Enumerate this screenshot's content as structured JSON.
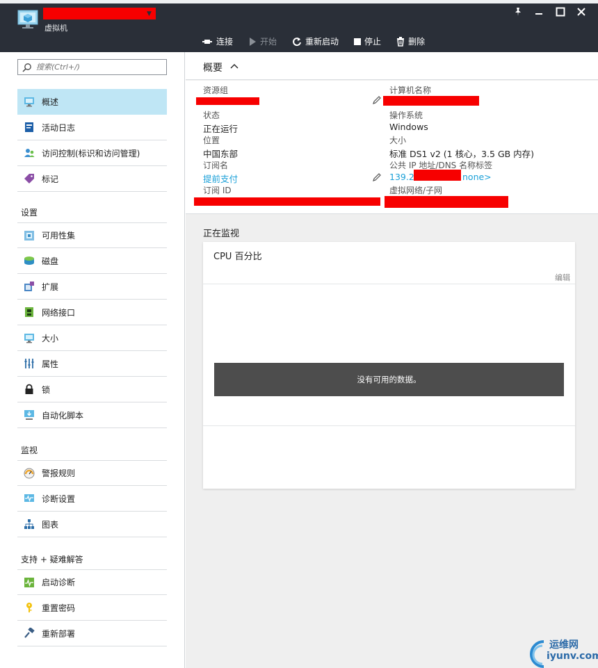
{
  "header": {
    "subtitle": "虚拟机",
    "icons": [
      "vm-monitor-icon",
      "pin-icon",
      "minimize-icon",
      "maximize-icon",
      "close-icon"
    ],
    "toolbar": [
      {
        "label": "连接",
        "icon": "connect-icon"
      },
      {
        "label": "开始",
        "icon": "play-icon"
      },
      {
        "label": "重新启动",
        "icon": "restart-icon"
      },
      {
        "label": "停止",
        "icon": "stop-icon"
      },
      {
        "label": "删除",
        "icon": "trash-icon"
      }
    ]
  },
  "sidebar": {
    "search_placeholder": "搜索(Ctrl+/)",
    "items": [
      {
        "label": "概述",
        "icon": "overview-monitor-icon",
        "active": true
      },
      {
        "label": "活动日志",
        "icon": "activity-log-icon"
      },
      {
        "label": "访问控制(标识和访问管理)",
        "icon": "access-control-icon"
      },
      {
        "label": "标记",
        "icon": "tag-icon"
      }
    ],
    "settings_header": "设置",
    "settings_items": [
      {
        "label": "可用性集",
        "icon": "availability-set-icon"
      },
      {
        "label": "磁盘",
        "icon": "disk-icon"
      },
      {
        "label": "扩展",
        "icon": "extension-icon"
      },
      {
        "label": "网络接口",
        "icon": "network-interface-icon"
      },
      {
        "label": "大小",
        "icon": "size-monitor-icon"
      },
      {
        "label": "属性",
        "icon": "properties-icon"
      },
      {
        "label": "锁",
        "icon": "lock-icon"
      },
      {
        "label": "自动化脚本",
        "icon": "automation-script-icon"
      }
    ],
    "monitor_header": "监视",
    "monitor_items": [
      {
        "label": "警报规则",
        "icon": "alert-rules-icon"
      },
      {
        "label": "诊断设置",
        "icon": "diagnostics-settings-icon"
      },
      {
        "label": "图表",
        "icon": "diagram-icon"
      }
    ],
    "support_header": "支持 + 疑难解答",
    "support_items": [
      {
        "label": "启动诊断",
        "icon": "boot-diagnostics-icon"
      },
      {
        "label": "重置密码",
        "icon": "key-icon"
      },
      {
        "label": "重新部署",
        "icon": "hammer-icon"
      }
    ]
  },
  "overview": {
    "title": "概要",
    "left": {
      "resource_group_label": "资源组",
      "status_label": "状态",
      "status_value": "正在运行",
      "location_label": "位置",
      "location_value": "中国东部",
      "subscription_label": "订阅名",
      "subscription_value": "提前支付",
      "subscription_id_label": "订阅 ID"
    },
    "right": {
      "computer_name_label": "计算机名称",
      "os_label": "操作系统",
      "os_value": "Windows",
      "size_label": "大小",
      "size_value": "标准 DS1 v2 (1 核心，3.5 GB 内存)",
      "ip_label": "公共 IP 地址/DNS 名称标签",
      "ip_value_prefix": "139.2",
      "ip_value_suffix": "none>",
      "vnet_label": "虚拟网络/子网"
    }
  },
  "monitoring": {
    "title": "正在监视",
    "tile_title": "CPU 百分比",
    "edit_label": "编辑",
    "no_data": "没有可用的数据。"
  },
  "watermark": {
    "line1": "运维网",
    "line2": "iyunv.com"
  },
  "colors": {
    "header_bg": "#2a2f38",
    "active_item_bg": "#bfe6f5",
    "link": "#1aa0d8",
    "redaction": "#f70000",
    "no_data_bg": "#4d4d4d"
  }
}
